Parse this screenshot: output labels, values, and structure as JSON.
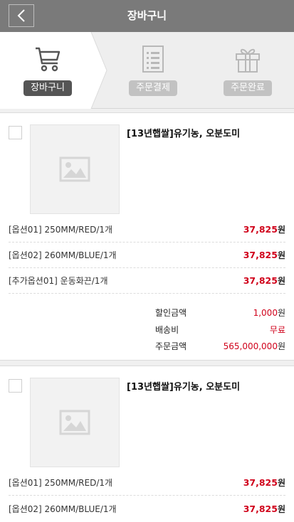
{
  "header": {
    "title": "장바구니"
  },
  "steps": [
    {
      "label": "장바구니",
      "active": true,
      "icon": "cart-icon"
    },
    {
      "label": "주문결제",
      "active": false,
      "icon": "receipt-icon"
    },
    {
      "label": "주문완료",
      "active": false,
      "icon": "gift-icon"
    }
  ],
  "currency": "원",
  "cart": [
    {
      "product_name": "[13년햅쌀]유기농, 오분도미",
      "options": [
        {
          "name": "[옵션01] 250MM/RED/1개",
          "price": "37,825"
        },
        {
          "name": "[옵션02] 260MM/BLUE/1개",
          "price": "37,825"
        },
        {
          "name": "[추가옵션01] 운동화끈/1개",
          "price": "37,825"
        }
      ],
      "summary": {
        "discount_label": "할인금액",
        "discount_value": "1,000",
        "shipping_label": "배송비",
        "shipping_value": "무료",
        "order_label": "주문금액",
        "order_value": "565,000,000"
      }
    },
    {
      "product_name": "[13년햅쌀]유기농, 오분도미",
      "options": [
        {
          "name": "[옵션01] 250MM/RED/1개",
          "price": "37,825"
        },
        {
          "name": "[옵션02] 260MM/BLUE/1개",
          "price": "37,825"
        }
      ]
    }
  ]
}
